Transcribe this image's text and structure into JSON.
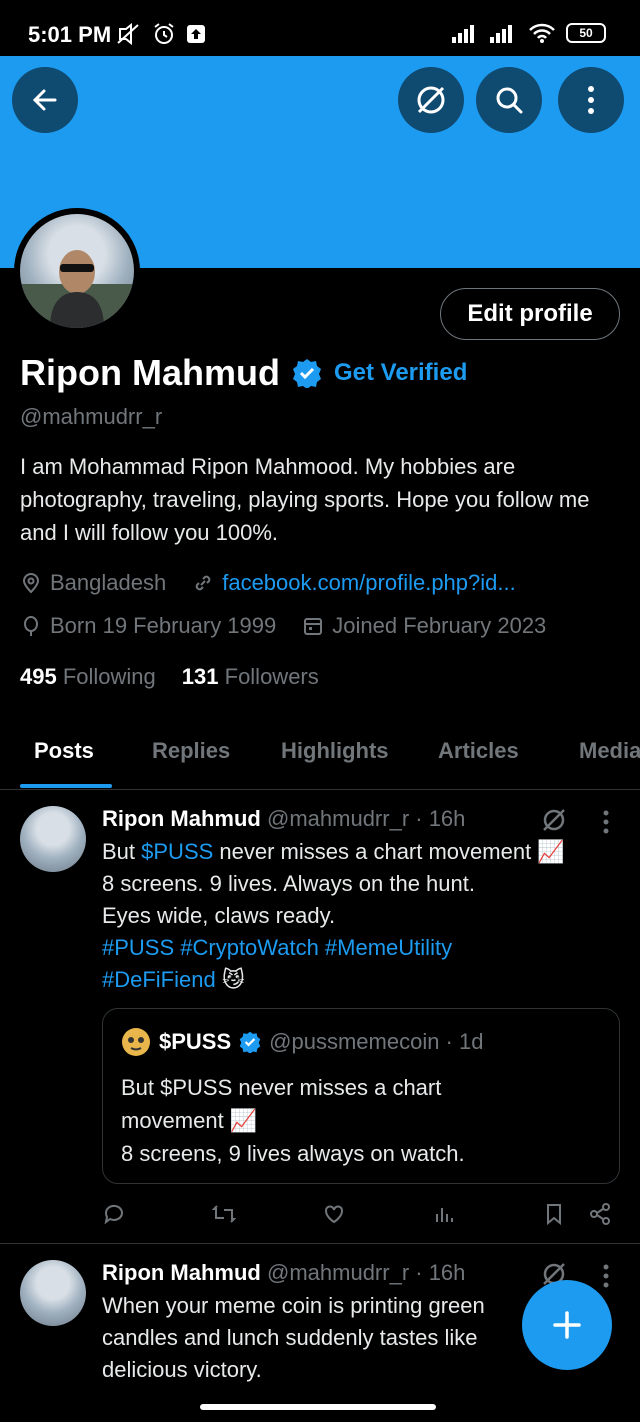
{
  "status": {
    "time": "5:01 PM",
    "battery": "50"
  },
  "profile": {
    "name": "Ripon Mahmud",
    "get_verified": "Get Verified",
    "handle": "@mahmudrr_r",
    "bio": "I am Mohammad Ripon Mahmood.  My hobbies are photography, traveling, playing sports.  Hope you follow me and I will follow you 100%.",
    "location": "Bangladesh",
    "link": "facebook.com/profile.php?id...",
    "born": "Born 19 February 1999",
    "joined": "Joined February 2023",
    "following_count": "495",
    "following_label": "Following",
    "followers_count": "131",
    "followers_label": "Followers",
    "edit_label": "Edit profile"
  },
  "tabs": [
    "Posts",
    "Replies",
    "Highlights",
    "Articles",
    "Media"
  ],
  "posts": [
    {
      "author": "Ripon Mahmud",
      "meta": "@mahmudrr_r · 16h",
      "line1_pre": "But ",
      "line1_tag": "$PUSS",
      "line1_post": " never misses a chart movement 📈",
      "line2": "8 screens. 9 lives. Always on the hunt.",
      "line3": "Eyes wide, claws ready.",
      "line4": "#PUSS #CryptoWatch #MemeUtility",
      "line5_tag": "#DeFiFiend",
      "line5_emoji": " 😼",
      "quote": {
        "name": "$PUSS",
        "meta": "@pussmemecoin · 1d",
        "line1": "But $PUSS never misses a chart",
        "line2": "movement 📈",
        "line3": "8 screens, 9 lives always on watch."
      }
    },
    {
      "author": "Ripon Mahmud",
      "meta": "@mahmudrr_r · 16h",
      "line1": "When your meme coin is printing green",
      "line2": "candles and lunch suddenly tastes like",
      "line3": "delicious victory."
    }
  ]
}
